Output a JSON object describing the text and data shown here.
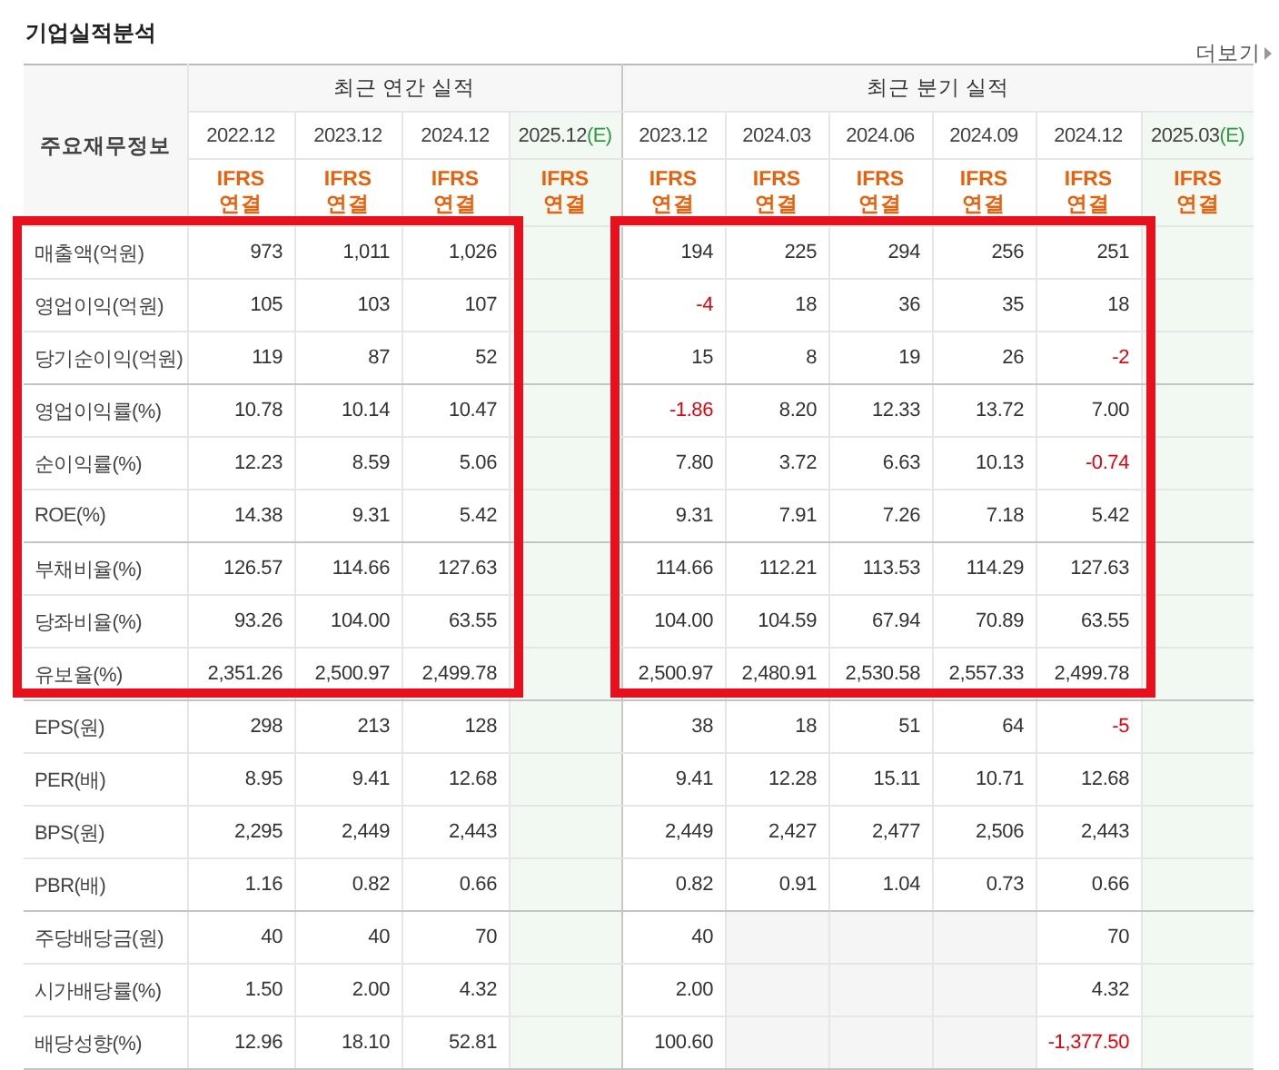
{
  "title": "기업실적분석",
  "more_link": "더보기",
  "label_column": {
    "header": "주요재무정보"
  },
  "column_groups": [
    {
      "title": "최근 연간 실적",
      "highlighted": true,
      "columns": [
        {
          "period": "2022.12",
          "estimate": false,
          "basis": "IFRS",
          "consolidation": "연결"
        },
        {
          "period": "2023.12",
          "estimate": false,
          "basis": "IFRS",
          "consolidation": "연결"
        },
        {
          "period": "2024.12",
          "estimate": false,
          "basis": "IFRS",
          "consolidation": "연결"
        },
        {
          "period": "2025.12",
          "estimate_mark": "(E)",
          "estimate": true,
          "basis": "IFRS",
          "consolidation": "연결"
        }
      ]
    },
    {
      "title": "최근 분기 실적",
      "highlighted": true,
      "columns": [
        {
          "period": "2023.12",
          "estimate": false,
          "basis": "IFRS",
          "consolidation": "연결"
        },
        {
          "period": "2024.03",
          "estimate": false,
          "basis": "IFRS",
          "consolidation": "연결"
        },
        {
          "period": "2024.06",
          "estimate": false,
          "basis": "IFRS",
          "consolidation": "연결"
        },
        {
          "period": "2024.09",
          "estimate": false,
          "basis": "IFRS",
          "consolidation": "연결"
        },
        {
          "period": "2024.12",
          "estimate": false,
          "basis": "IFRS",
          "consolidation": "연결"
        },
        {
          "period": "2025.03",
          "estimate_mark": "(E)",
          "estimate": true,
          "basis": "IFRS",
          "consolidation": "연결"
        }
      ]
    }
  ],
  "sections": [
    {
      "highlighted": true,
      "row_groups": [
        {
          "rows": [
            {
              "label": "매출액(억원)",
              "values": [
                "973",
                "1,011",
                "1,026",
                "194",
                "225",
                "294",
                "256",
                "251"
              ]
            },
            {
              "label": "영업이익(억원)",
              "values": [
                "105",
                "103",
                "107",
                {
                  "text": "-4",
                  "negative": true
                },
                "18",
                "36",
                "35",
                "18"
              ]
            },
            {
              "label": "당기순이익(억원)",
              "values": [
                "119",
                "87",
                "52",
                "15",
                "8",
                "19",
                "26",
                {
                  "text": "-2",
                  "negative": true
                }
              ]
            }
          ]
        },
        {
          "rows": [
            {
              "label": "영업이익률(%)",
              "values": [
                "10.78",
                "10.14",
                "10.47",
                {
                  "text": "-1.86",
                  "negative": true
                },
                "8.20",
                "12.33",
                "13.72",
                "7.00"
              ]
            },
            {
              "label": "순이익률(%)",
              "values": [
                "12.23",
                "8.59",
                "5.06",
                "7.80",
                "3.72",
                "6.63",
                "10.13",
                {
                  "text": "-0.74",
                  "negative": true
                }
              ]
            },
            {
              "label": "ROE(%)",
              "values": [
                "14.38",
                "9.31",
                "5.42",
                "9.31",
                "7.91",
                "7.26",
                "7.18",
                "5.42"
              ]
            }
          ]
        },
        {
          "rows": [
            {
              "label": "부채비율(%)",
              "values": [
                "126.57",
                "114.66",
                "127.63",
                "114.66",
                "112.21",
                "113.53",
                "114.29",
                "127.63"
              ]
            },
            {
              "label": "당좌비율(%)",
              "values": [
                "93.26",
                "104.00",
                "63.55",
                "104.00",
                "104.59",
                "67.94",
                "70.89",
                "63.55"
              ]
            },
            {
              "label": "유보율(%)",
              "values": [
                "2,351.26",
                "2,500.97",
                "2,499.78",
                "2,500.97",
                "2,480.91",
                "2,530.58",
                "2,557.33",
                "2,499.78"
              ]
            }
          ]
        }
      ]
    },
    {
      "highlighted": false,
      "row_groups": [
        {
          "rows": [
            {
              "label": "EPS(원)",
              "values": [
                "298",
                "213",
                "128",
                "38",
                "18",
                "51",
                "64",
                {
                  "text": "-5",
                  "negative": true
                }
              ]
            },
            {
              "label": "PER(배)",
              "values": [
                "8.95",
                "9.41",
                "12.68",
                "9.41",
                "12.28",
                "15.11",
                "10.71",
                "12.68"
              ]
            },
            {
              "label": "BPS(원)",
              "values": [
                "2,295",
                "2,449",
                "2,443",
                "2,449",
                "2,427",
                "2,477",
                "2,506",
                "2,443"
              ]
            },
            {
              "label": "PBR(배)",
              "values": [
                "1.16",
                "0.82",
                "0.66",
                "0.82",
                "0.91",
                "1.04",
                "0.73",
                "0.66"
              ]
            }
          ]
        },
        {
          "rows": [
            {
              "label": "주당배당금(원)",
              "values": [
                "40",
                "40",
                "70",
                "40",
                {
                  "blank": true
                },
                {
                  "blank": true
                },
                {
                  "blank": true
                },
                "70"
              ]
            },
            {
              "label": "시가배당률(%)",
              "values": [
                "1.50",
                "2.00",
                "4.32",
                "2.00",
                {
                  "blank": true
                },
                {
                  "blank": true
                },
                {
                  "blank": true
                },
                "4.32"
              ]
            },
            {
              "label": "배당성향(%)",
              "values": [
                "12.96",
                "18.10",
                "52.81",
                "100.60",
                {
                  "blank": true
                },
                {
                  "blank": true
                },
                {
                  "blank": true
                },
                {
                  "text": "-1,377.50",
                  "negative": true
                }
              ]
            }
          ]
        }
      ]
    }
  ]
}
